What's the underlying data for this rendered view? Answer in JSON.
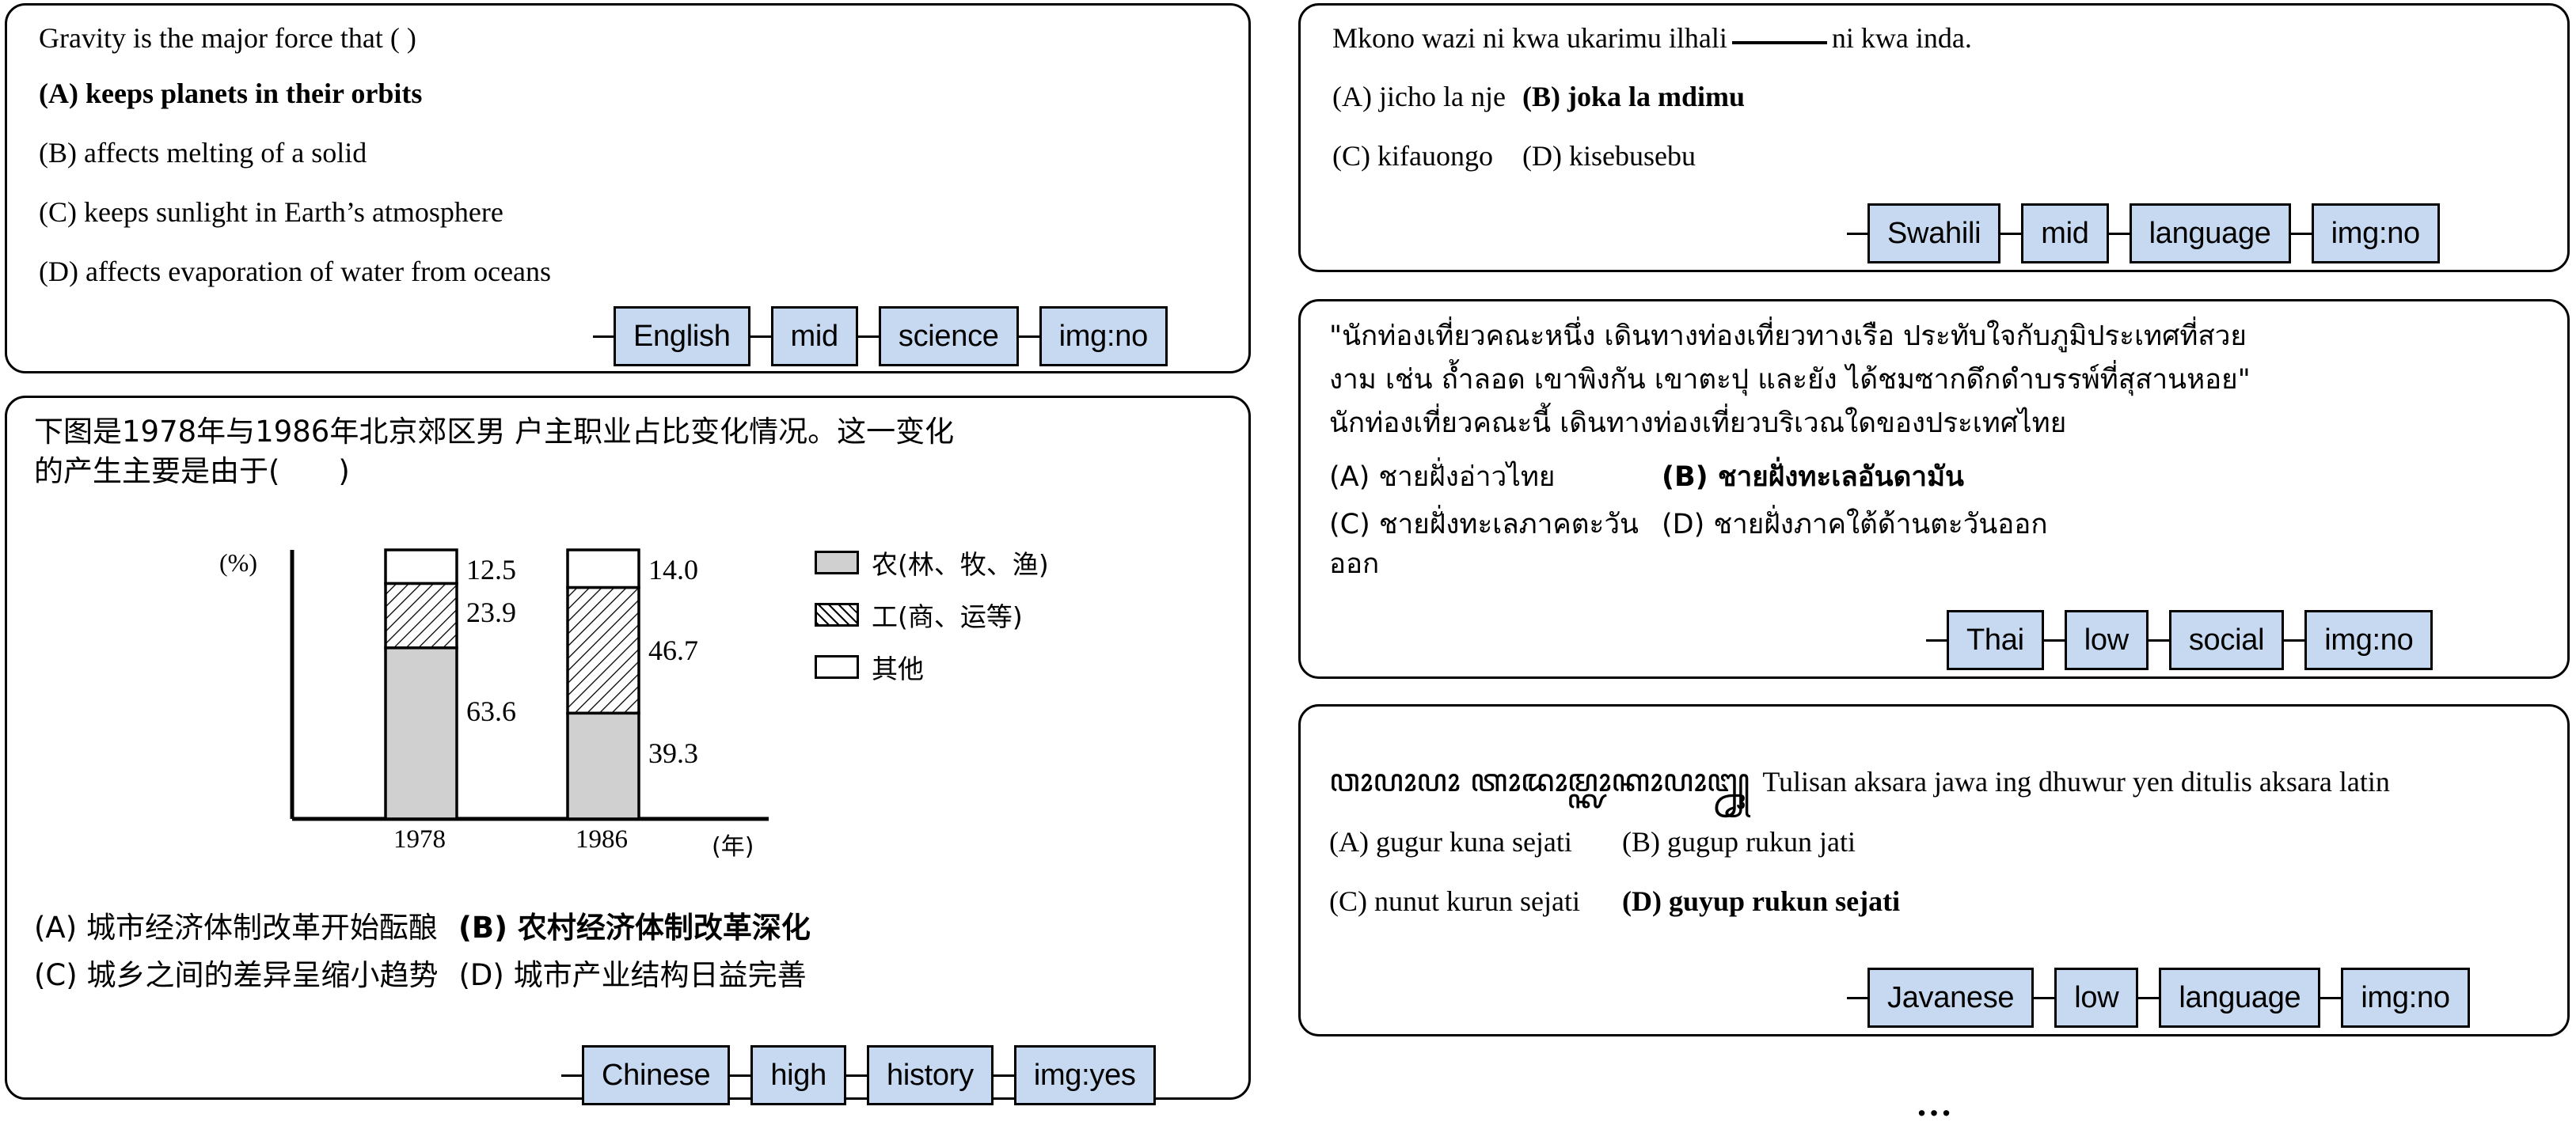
{
  "colors": {
    "tag_fill": "#c6d9f1",
    "border": "#000000",
    "bar_gray": "#d0d0d0"
  },
  "panels": [
    {
      "id": "english-science",
      "stem": "Gravity is the major force that ( )",
      "options": [
        {
          "label": "(A) keeps planets in their orbits",
          "bold": true
        },
        {
          "label": "(B) affects melting of a solid",
          "bold": false
        },
        {
          "label": "(C) keeps sunlight in Earth’s atmosphere",
          "bold": false
        },
        {
          "label": "(D) affects evaporation of water from oceans",
          "bold": false
        }
      ],
      "tags": [
        "English",
        "mid",
        "science",
        "img:no"
      ]
    },
    {
      "id": "chinese-history",
      "stem_line1": "下图是1978年与1986年北京郊区男 户主职业占比变化情况。这一变化",
      "stem_line2": "的产生主要是由于(　　)",
      "options_row1": [
        {
          "label": "(A) 城市经济体制改革开始酝酿",
          "bold": false
        },
        {
          "label": "(B) 农村经济体制改革深化",
          "bold": true
        }
      ],
      "options_row2": [
        {
          "label": "(C) 城乡之间的差异呈缩小趋势",
          "bold": false
        },
        {
          "label": "(D) 城市产业结构日益完善",
          "bold": false
        }
      ],
      "tags": [
        "Chinese",
        "high",
        "history",
        "img:yes"
      ]
    },
    {
      "id": "swahili-language",
      "stem_before": "Mkono wazi ni kwa ukarimu ilhali",
      "stem_after": "ni kwa inda.",
      "options_row1": [
        {
          "label": "(A) jicho la nje",
          "bold": false
        },
        {
          "label": "(B) joka la mdimu",
          "bold": true
        }
      ],
      "options_row2": [
        {
          "label": "(C) kifauongo",
          "bold": false
        },
        {
          "label": "(D) kisebusebu",
          "bold": false
        }
      ],
      "tags": [
        "Swahili",
        "mid",
        "language",
        "img:no"
      ]
    },
    {
      "id": "thai-social",
      "stem_line1": "\"นักท่องเที่ยวคณะหนึ่ง เดินทางท่องเที่ยวทางเรือ ประทับใจกับภูมิประเทศที่สวย",
      "stem_line2": "งาม เช่น ถ้ำลอด เขาพิงกัน เขาตะปุ และยัง ได้ชมซากดึกดำบรรพ์ที่สุสานหอย\"",
      "stem_line3": "นักท่องเที่ยวคณะนี้ เดินทางท่องเที่ยวบริเวณใดของประเทศไทย",
      "options_row1": [
        {
          "label": "(A) ชายฝั่งอ่าวไทย",
          "bold": false
        },
        {
          "label": "(B) ชายฝั่งทะเลอันดามัน",
          "bold": true
        }
      ],
      "options_row2": [
        {
          "label": "(C) ชายฝั่งทะเลภาคตะวันออก",
          "bold": false
        },
        {
          "label": "(D) ชายฝั่งภาคใต้ด้านตะวันออก",
          "bold": false
        }
      ],
      "tags": [
        "Thai",
        "low",
        "social",
        "img:no"
      ]
    },
    {
      "id": "javanese-language",
      "stem_script": "ꦮꦴꦥꦴꦥꦴ ꦠꦴꦢꦴꦩ꧀ꦑꦴꦏꦴꦥꦴꦋ꧀",
      "stem_latin": "Tulisan aksara jawa ing dhuwur yen ditulis aksara latin",
      "options_row1": [
        {
          "label": "(A) gugur kuna sejati",
          "bold": false
        },
        {
          "label": "(B) gugup rukun jati",
          "bold": false
        }
      ],
      "options_row2": [
        {
          "label": "(C) nunut kurun sejati",
          "bold": false
        },
        {
          "label": "(D) guyup rukun sejati",
          "bold": true
        }
      ],
      "tags": [
        "Javanese",
        "low",
        "language",
        "img:no"
      ]
    }
  ],
  "ellipsis": "…",
  "chart_data": {
    "type": "bar",
    "subtype": "stacked-bar-100",
    "title": "",
    "xlabel": "(年)",
    "ylabel": "(%)",
    "categories": [
      "1978",
      "1986"
    ],
    "grid": false,
    "legend_position": "right",
    "ylim": [
      0,
      100
    ],
    "series": [
      {
        "name": "农(林、牧、渔)",
        "pattern": "gray",
        "values": [
          63.6,
          39.3
        ]
      },
      {
        "name": "工(商、运等)",
        "pattern": "hatch",
        "values": [
          23.9,
          46.7
        ]
      },
      {
        "name": "其他",
        "pattern": "white",
        "values": [
          12.5,
          14.0
        ]
      }
    ],
    "data_labels": {
      "1978": [
        "63.6",
        "23.9",
        "12.5"
      ],
      "1986": [
        "39.3",
        "46.7",
        "14.0"
      ]
    }
  }
}
